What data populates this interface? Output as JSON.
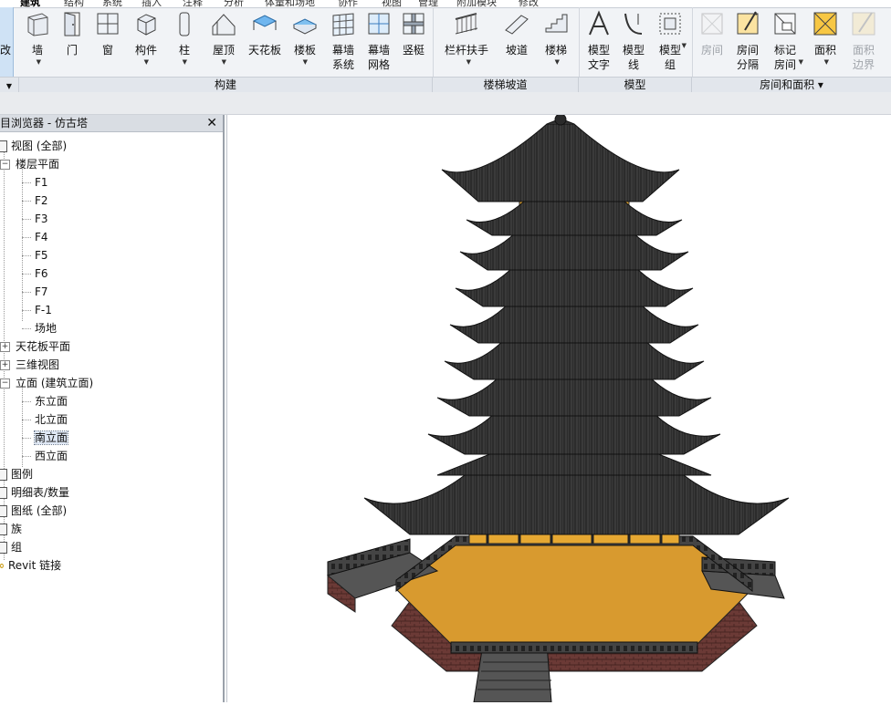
{
  "ribbon": {
    "tabs": [
      "建筑",
      "结构",
      "系统",
      "插入",
      "注释",
      "分析",
      "体量和场地",
      "协作",
      "视图",
      "管理",
      "附加模块",
      "修改"
    ],
    "left_stub_label": "改",
    "buttons": [
      {
        "label": "墙",
        "icon": "wall-icon",
        "dropdown": true
      },
      {
        "label": "门",
        "icon": "door-icon",
        "dropdown": false
      },
      {
        "label": "窗",
        "icon": "window-icon",
        "dropdown": false
      },
      {
        "label": "构件",
        "icon": "component-icon",
        "dropdown": true
      },
      {
        "label": "柱",
        "icon": "column-icon",
        "dropdown": true
      },
      {
        "label": "屋顶",
        "icon": "roof-icon",
        "dropdown": true
      },
      {
        "label": "天花板",
        "icon": "ceiling-icon",
        "dropdown": false
      },
      {
        "label": "楼板",
        "icon": "floor-icon",
        "dropdown": true
      },
      {
        "label": "幕墙\n系统",
        "icon": "curtain-system-icon",
        "dropdown": false
      },
      {
        "label": "幕墙\n网格",
        "icon": "curtain-grid-icon",
        "dropdown": false
      },
      {
        "label": "竖梃",
        "icon": "mullion-icon",
        "dropdown": false
      },
      {
        "label": "栏杆扶手",
        "icon": "railing-icon",
        "dropdown": true
      },
      {
        "label": "坡道",
        "icon": "ramp-icon",
        "dropdown": false
      },
      {
        "label": "楼梯",
        "icon": "stair-icon",
        "dropdown": true
      },
      {
        "label": "模型\n文字",
        "icon": "model-text-icon",
        "dropdown": false
      },
      {
        "label": "模型\n线",
        "icon": "model-line-icon",
        "dropdown": false
      },
      {
        "label": "模型\n组",
        "icon": "model-group-icon",
        "dropdown": true
      },
      {
        "label": "房间",
        "icon": "room-icon",
        "dropdown": false,
        "disabled": true
      },
      {
        "label": "房间\n分隔",
        "icon": "room-separator-icon",
        "dropdown": false
      },
      {
        "label": "标记\n房间",
        "icon": "tag-room-icon",
        "dropdown": true
      },
      {
        "label": "面积",
        "icon": "area-icon",
        "dropdown": true
      },
      {
        "label": "面积\n边界",
        "icon": "area-boundary-icon",
        "dropdown": false,
        "disabled": true
      }
    ],
    "groups": [
      "构建",
      "楼梯坡道",
      "模型",
      "房间和面积 ▾"
    ],
    "accent": "#f7c744"
  },
  "browser": {
    "title": "项目浏览器 - 仿古塔",
    "close": "✕",
    "items": [
      {
        "label": "视图 (全部)",
        "level": 0,
        "exp": "−"
      },
      {
        "label": "楼层平面",
        "level": 1,
        "exp": "−"
      },
      {
        "label": "F1",
        "level": 2
      },
      {
        "label": "F2",
        "level": 2
      },
      {
        "label": "F3",
        "level": 2
      },
      {
        "label": "F4",
        "level": 2
      },
      {
        "label": "F5",
        "level": 2
      },
      {
        "label": "F6",
        "level": 2
      },
      {
        "label": "F7",
        "level": 2
      },
      {
        "label": "F-1",
        "level": 2
      },
      {
        "label": "场地",
        "level": 2
      },
      {
        "label": "天花板平面",
        "level": 1,
        "exp": "+"
      },
      {
        "label": "三维视图",
        "level": 1,
        "exp": "+"
      },
      {
        "label": "立面 (建筑立面)",
        "level": 1,
        "exp": "−"
      },
      {
        "label": "东立面",
        "level": 2
      },
      {
        "label": "北立面",
        "level": 2
      },
      {
        "label": "南立面",
        "level": 2,
        "selected": true
      },
      {
        "label": "西立面",
        "level": 2
      },
      {
        "label": "图例",
        "level": 0
      },
      {
        "label": "明细表/数量",
        "level": 0
      },
      {
        "label": "图纸 (全部)",
        "level": 0
      },
      {
        "label": "族",
        "level": 0
      },
      {
        "label": "组",
        "level": 0
      },
      {
        "label": "Revit 链接",
        "level": 0
      }
    ]
  },
  "viewport": {
    "colors": {
      "roof": "#2f2f2f",
      "wall": "#e6a832",
      "base": "#6b3a36",
      "platform": "#d89a2f"
    }
  }
}
